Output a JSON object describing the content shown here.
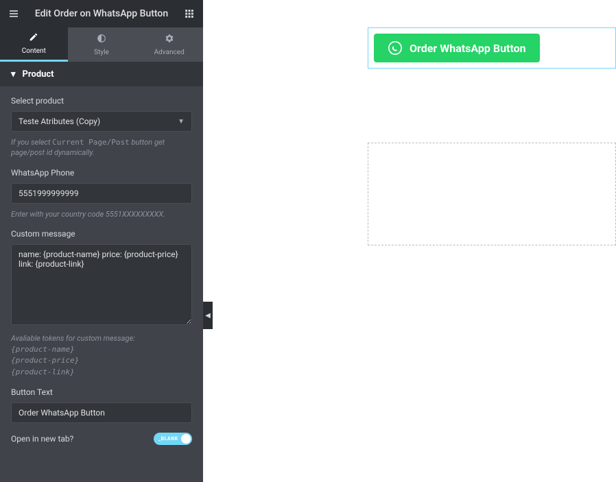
{
  "header": {
    "title": "Edit Order on WhatsApp Button"
  },
  "tabs": {
    "content": "Content",
    "style": "Style",
    "advanced": "Advanced"
  },
  "section": {
    "title": "Product"
  },
  "fields": {
    "select_product": {
      "label": "Select product",
      "value": "Teste Atributes (Copy)",
      "hint_prefix": "If you select ",
      "hint_code": "Current Page/Post",
      "hint_suffix": " button get page/post id dynamically."
    },
    "phone": {
      "label": "WhatsApp Phone",
      "value": "5551999999999",
      "hint": "Enter with your country code 5551XXXXXXXXX."
    },
    "message": {
      "label": "Custom message",
      "value": "name: {product-name} price: {product-price}\nlink: {product-link}",
      "tokens_label": "Avaliable tokens for custom message:",
      "tokens": [
        "{product-name}",
        "{product-price}",
        "{product-link}"
      ]
    },
    "button_text": {
      "label": "Button Text",
      "value": "Order WhatsApp Button"
    },
    "open_new_tab": {
      "label": "Open in new tab?",
      "value": "_BLANK"
    }
  },
  "canvas": {
    "button_label": "Order WhatsApp Button"
  }
}
